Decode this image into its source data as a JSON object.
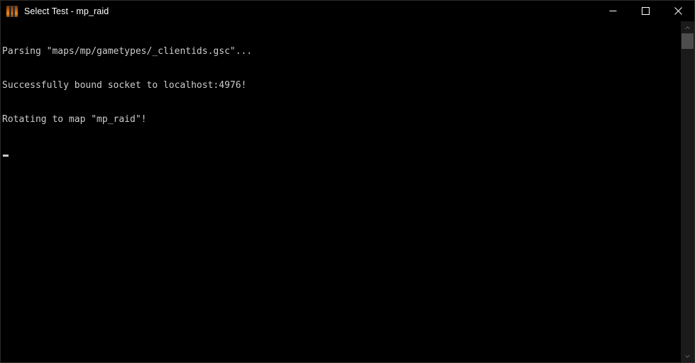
{
  "window": {
    "title": "Select Test - mp_raid",
    "icon": "console-app-icon",
    "icon_colors": {
      "background_orange": "#d4660c",
      "bars": "#2e2e30"
    },
    "background": "#000000",
    "border_color": "#2b2b2b"
  },
  "titlebar": {
    "minimize_label": "—",
    "maximize_label": "□",
    "close_label": "×",
    "minimize_icon": "minimize-icon",
    "maximize_icon": "maximize-icon",
    "close_icon": "close-icon"
  },
  "console": {
    "background": "#000000",
    "text_color": "#cccccc",
    "font_size_px": 13,
    "lines": [
      "Parsing \"maps/mp/gametypes/_clientids.gsc\"...",
      "Successfully bound socket to localhost:4976!",
      "Rotating to map \"mp_raid\"!"
    ],
    "cursor": {
      "visible": true,
      "shape": "underscore-block",
      "color": "#cccccc",
      "line_index": 3,
      "column": 0
    }
  },
  "scrollbar": {
    "orientation": "vertical",
    "track_color": "#1a1a1a",
    "thumb_color": "#4d4d4d",
    "up_arrow_icon": "chevron-up-icon",
    "down_arrow_icon": "chevron-down-icon",
    "thumb_position_percent": 0,
    "thumb_size_percent": 5
  }
}
